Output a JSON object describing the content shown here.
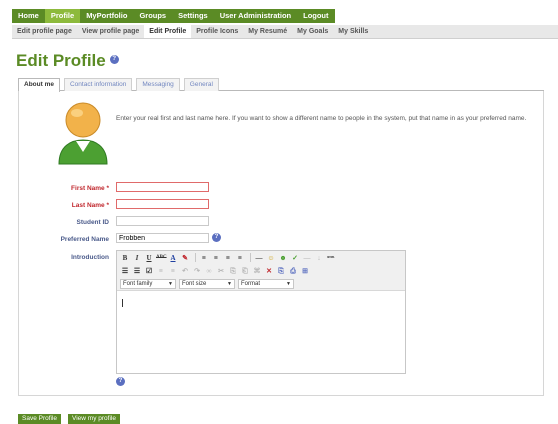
{
  "topnav": {
    "items": [
      "Home",
      "Profile",
      "MyPortfolio",
      "Groups",
      "Settings",
      "User Administration",
      "Logout"
    ],
    "active": "Profile"
  },
  "subnav": {
    "items": [
      "Edit profile page",
      "View profile page",
      "Edit Profile",
      "Profile Icons",
      "My Resumé",
      "My Goals",
      "My Skills"
    ],
    "active": "Edit Profile"
  },
  "page": {
    "title": "Edit Profile",
    "help_icon_glyph": "?"
  },
  "tabs": {
    "items": [
      "About me",
      "Contact information",
      "Messaging",
      "General"
    ],
    "active": "About me"
  },
  "about": {
    "intro": "Enter your real first and last name here. If you want to show a different name to people in the system, put that name in as your preferred name.",
    "required_mark": "*",
    "fields": {
      "first_name": {
        "label": "First Name",
        "value": ""
      },
      "last_name": {
        "label": "Last Name",
        "value": ""
      },
      "student_id": {
        "label": "Student ID",
        "value": ""
      },
      "preferred_name": {
        "label": "Preferred Name",
        "value": "Frobben"
      }
    },
    "introduction_label": "Introduction"
  },
  "editor": {
    "toolbar1": [
      "B",
      "I",
      "U",
      "ABC",
      "A",
      "✎",
      "≡",
      "≡",
      "≡",
      "≡",
      "—",
      "☺",
      "☻",
      "✓",
      "—",
      "↓",
      "ᴴᵀᴹᴸ"
    ],
    "toolbar2": [
      "☰",
      "☰",
      "☑",
      "≡",
      "≡",
      "↶",
      "↷",
      "∞",
      "✂",
      "⎘",
      "⎗",
      "⌘",
      "✕",
      "⎘",
      "⎙",
      "⊞"
    ],
    "font_family": "Font family",
    "font_size": "Font size",
    "format": "Format",
    "dropdown_arrow": "▼"
  },
  "buttons": {
    "save": "Save Profile",
    "view": "View my profile"
  },
  "colors": {
    "nav_green": "#5b8b25",
    "nav_active": "#8dba3c",
    "required_red": "#c0272d",
    "link_blue": "#7287c0"
  }
}
